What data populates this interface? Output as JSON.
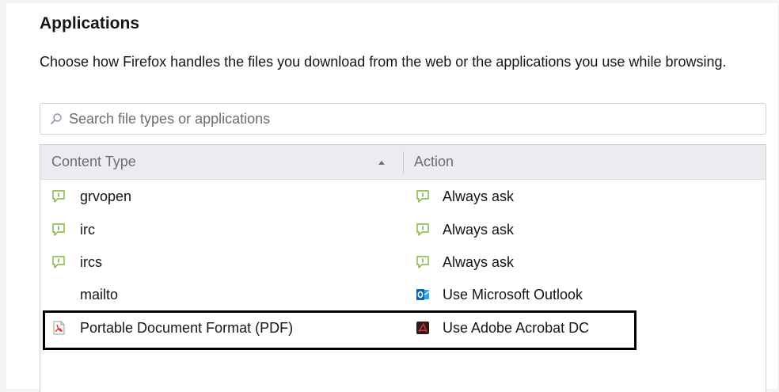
{
  "section": {
    "title": "Applications",
    "description": "Choose how Firefox handles the files you download from the web or the applications you use while browsing."
  },
  "search": {
    "placeholder": "Search file types or applications",
    "value": ""
  },
  "table": {
    "columns": {
      "content_type": "Content Type",
      "action": "Action"
    },
    "rows": [
      {
        "type": "grvopen",
        "type_icon": "chat-bubble-icon",
        "action": "Always ask",
        "action_icon": "chat-bubble-icon"
      },
      {
        "type": "irc",
        "type_icon": "chat-bubble-icon",
        "action": "Always ask",
        "action_icon": "chat-bubble-icon"
      },
      {
        "type": "ircs",
        "type_icon": "chat-bubble-icon",
        "action": "Always ask",
        "action_icon": "chat-bubble-icon"
      },
      {
        "type": "mailto",
        "type_icon": "",
        "action": "Use Microsoft Outlook",
        "action_icon": "outlook-icon"
      },
      {
        "type": "Portable Document Format (PDF)",
        "type_icon": "pdf-document-icon",
        "action": "Use Adobe Acrobat DC",
        "action_icon": "acrobat-icon"
      }
    ]
  },
  "colors": {
    "chat_icon_green": "#7cb342",
    "outlook_blue": "#0a64ad",
    "acrobat_dark": "#2b1b1b",
    "acrobat_red": "#d83030",
    "pdf_red": "#e02424",
    "highlight_border": "#000000"
  }
}
